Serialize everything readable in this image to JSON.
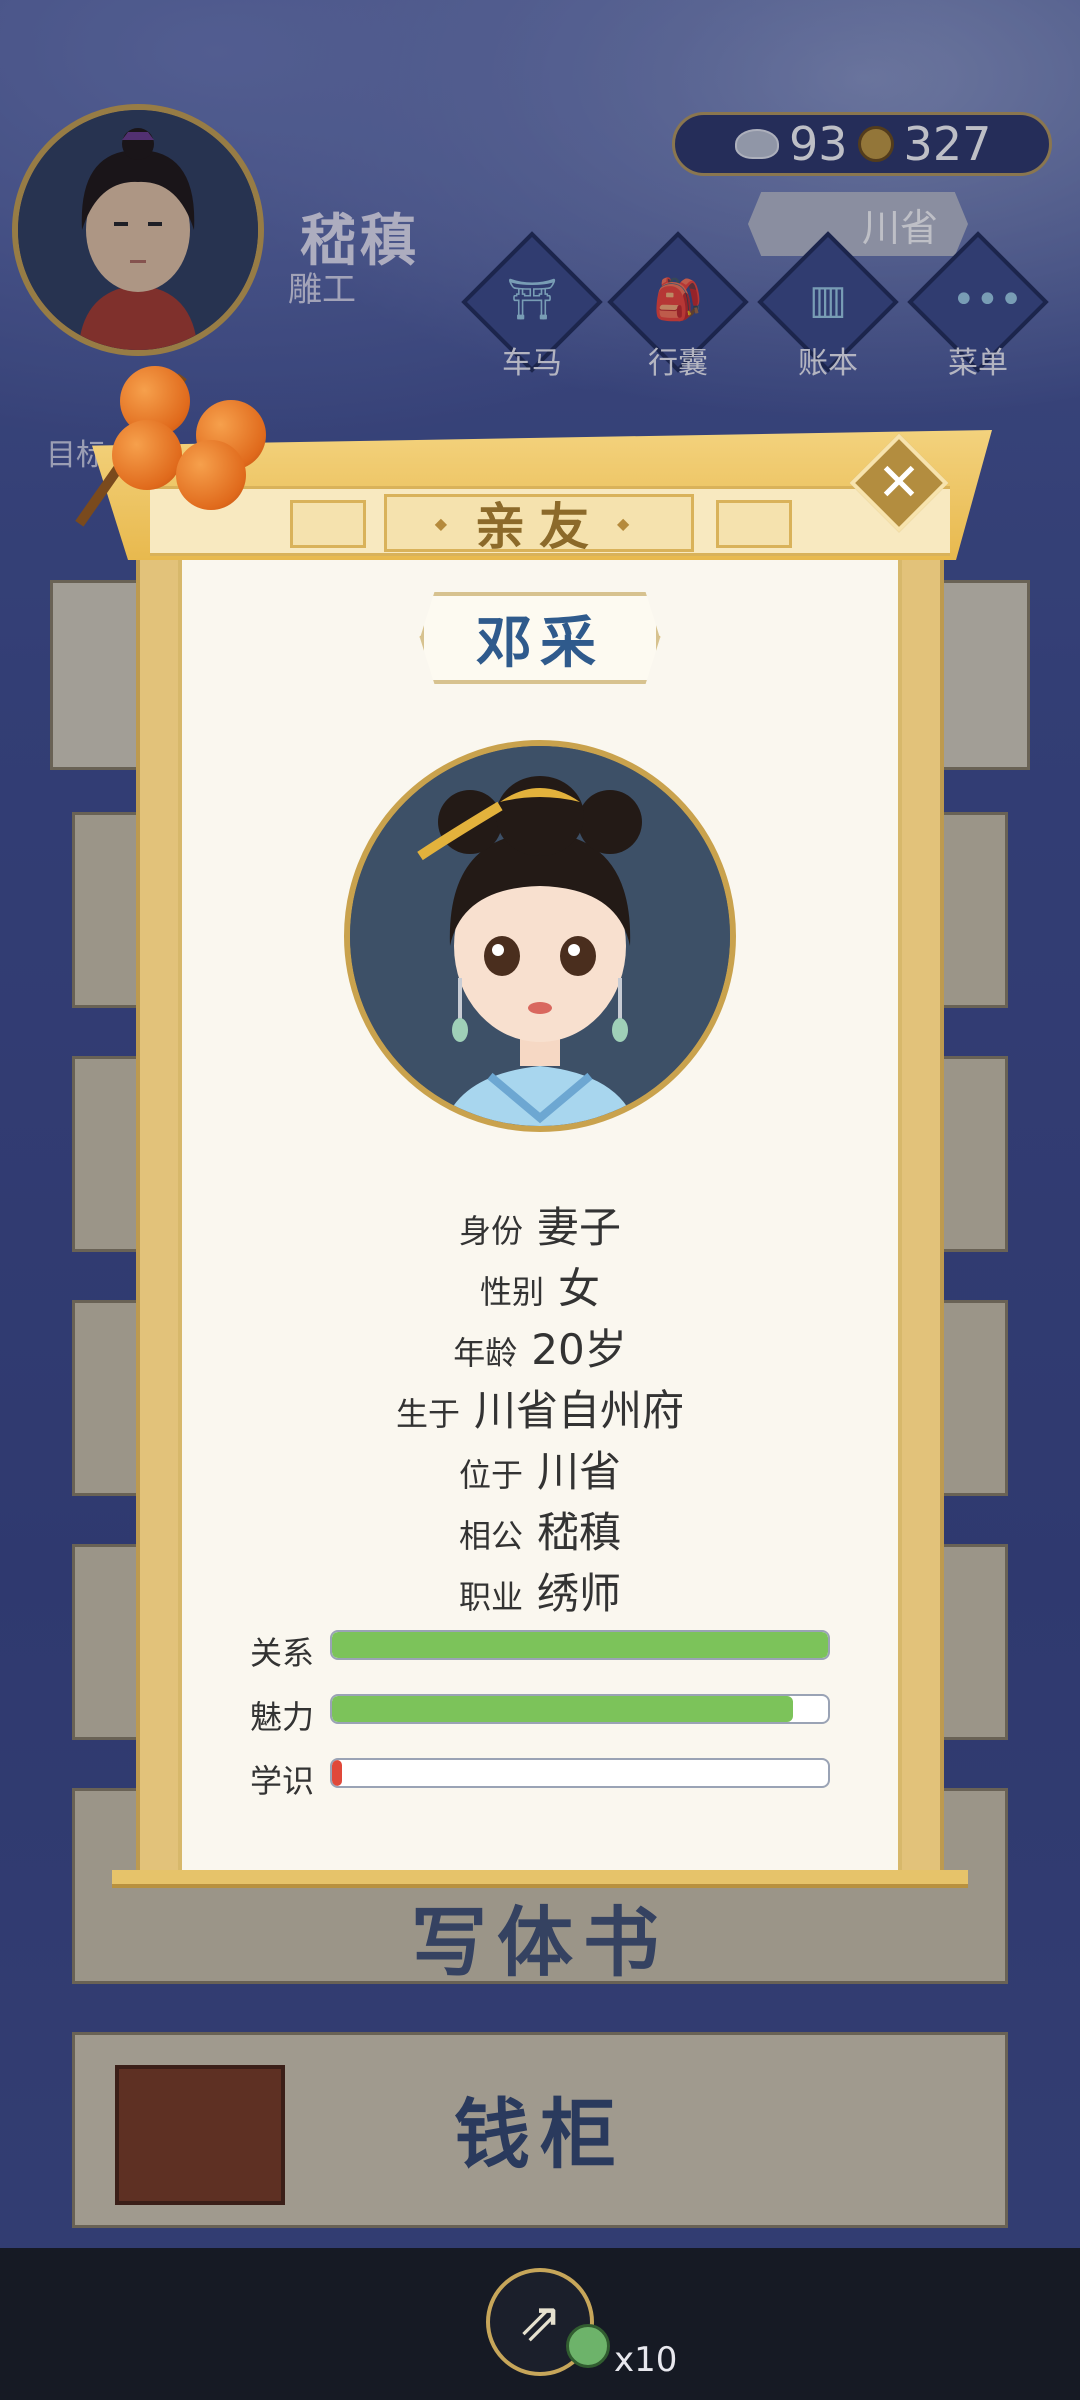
{
  "player": {
    "name": "嵇稹",
    "job": "雕工"
  },
  "currency": {
    "silver": "93",
    "copper": "327"
  },
  "location": "川省",
  "nav": [
    {
      "label": "车马",
      "icon": "carriage-icon"
    },
    {
      "label": "行囊",
      "icon": "bag-icon"
    },
    {
      "label": "账本",
      "icon": "ledger-icon"
    },
    {
      "label": "菜单",
      "icon": "menu-dots-icon"
    }
  ],
  "side_tab": {
    "label": "目标"
  },
  "background_cards": {
    "bottom_title": "钱柜",
    "partial_title": "写体书"
  },
  "dialog": {
    "title": "亲友",
    "name": "邓采",
    "info": [
      {
        "key": "身份",
        "value": "妻子"
      },
      {
        "key": "性别",
        "value": "女"
      },
      {
        "key": "年龄",
        "value": "20岁"
      },
      {
        "key": "生于",
        "value": "川省自州府"
      },
      {
        "key": "位于",
        "value": "川省"
      },
      {
        "key": "相公",
        "value": "嵇稹"
      },
      {
        "key": "职业",
        "value": "绣师"
      }
    ],
    "bars": [
      {
        "label": "关系",
        "value": 1.0,
        "color": "#7cc35a"
      },
      {
        "label": "魅力",
        "value": 0.93,
        "color": "#7cc35a"
      },
      {
        "label": "学识",
        "value": 0.02,
        "color": "#e0493a"
      }
    ]
  },
  "bottom": {
    "share_count": "x10"
  }
}
